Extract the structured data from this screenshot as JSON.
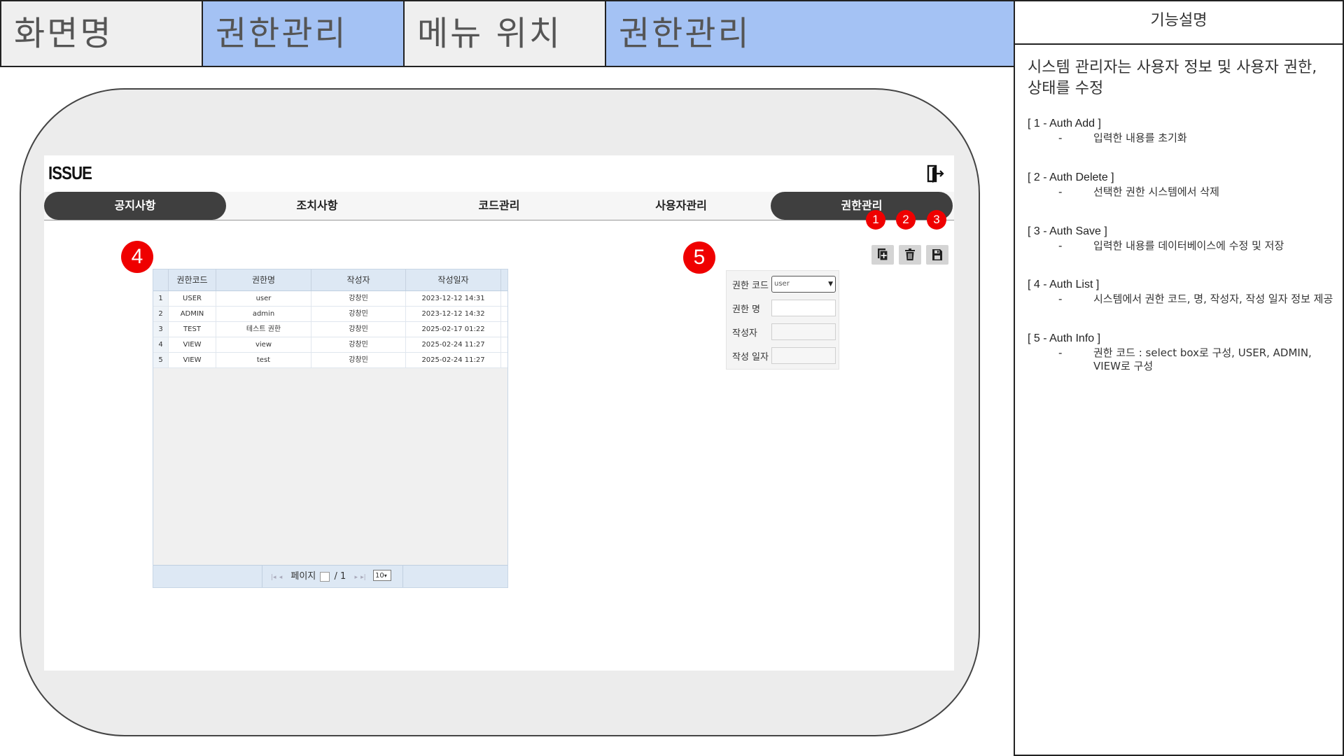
{
  "header": {
    "screen_name_label": "화면명",
    "screen_name_value": "권한관리",
    "menu_location_label": "메뉴 위치",
    "menu_location_value": "권한관리"
  },
  "description": {
    "title": "기능설명",
    "summary": "시스템 관리자는 사용자 정보 및 사용자 권한, 상태를 수정",
    "items": [
      {
        "title": "[ 1 - Auth Add ]",
        "text": "입력한 내용를 초기화"
      },
      {
        "title": "[ 2 - Auth Delete ]",
        "text": "선택한 권한 시스템에서 삭제"
      },
      {
        "title": "[ 3 - Auth Save ]",
        "text": "입력한 내용를 데이터베이스에 수정 및 저장"
      },
      {
        "title": "[ 4 - Auth List ]",
        "text": "시스템에서 권한 코드, 명, 작성자, 작성 일자 정보 제공"
      },
      {
        "title": "[ 5 - Auth Info ]",
        "text": "권한 코드 : select box로 구성, USER, ADMIN, VIEW로 구성"
      }
    ]
  },
  "app": {
    "brand": "ISSUE",
    "logout_icon": "logout-icon",
    "tabs": [
      {
        "label": "공지사항",
        "active": true
      },
      {
        "label": "조치사항",
        "active": false
      },
      {
        "label": "코드관리",
        "active": false
      },
      {
        "label": "사용자관리",
        "active": false
      },
      {
        "label": "권한관리",
        "active": true
      }
    ]
  },
  "markers": [
    "1",
    "2",
    "3",
    "4",
    "5"
  ],
  "toolbar": {
    "add_icon": "add-document-icon",
    "delete_icon": "trash-icon",
    "save_icon": "floppy-disk-icon"
  },
  "grid": {
    "columns": [
      "권한코드",
      "권한명",
      "작성자",
      "작성일자"
    ],
    "rows": [
      {
        "num": "1",
        "code": "USER",
        "name": "user",
        "author": "강창민",
        "date": "2023-12-12 14:31"
      },
      {
        "num": "2",
        "code": "ADMIN",
        "name": "admin",
        "author": "강창민",
        "date": "2023-12-12 14:32"
      },
      {
        "num": "3",
        "code": "TEST",
        "name": "테스트 권한",
        "author": "강창민",
        "date": "2025-02-17 01:22"
      },
      {
        "num": "4",
        "code": "VIEW",
        "name": "view",
        "author": "강창민",
        "date": "2025-02-24 11:27"
      },
      {
        "num": "5",
        "code": "VIEW",
        "name": "test",
        "author": "강창민",
        "date": "2025-02-24 11:27"
      }
    ],
    "pager": {
      "page_label": "페이지",
      "total": "/ 1",
      "page_size": "10"
    }
  },
  "form": {
    "fields": [
      {
        "label": "권한 코드",
        "value": "user"
      },
      {
        "label": "권한 명",
        "value": ""
      },
      {
        "label": "작성자",
        "value": ""
      },
      {
        "label": "작성 일자",
        "value": ""
      }
    ]
  },
  "colors": {
    "header_blue": "#a4c2f4",
    "header_gray": "#efefef",
    "marker_red": "#ef0000",
    "tab_active": "#3f3f3f"
  }
}
